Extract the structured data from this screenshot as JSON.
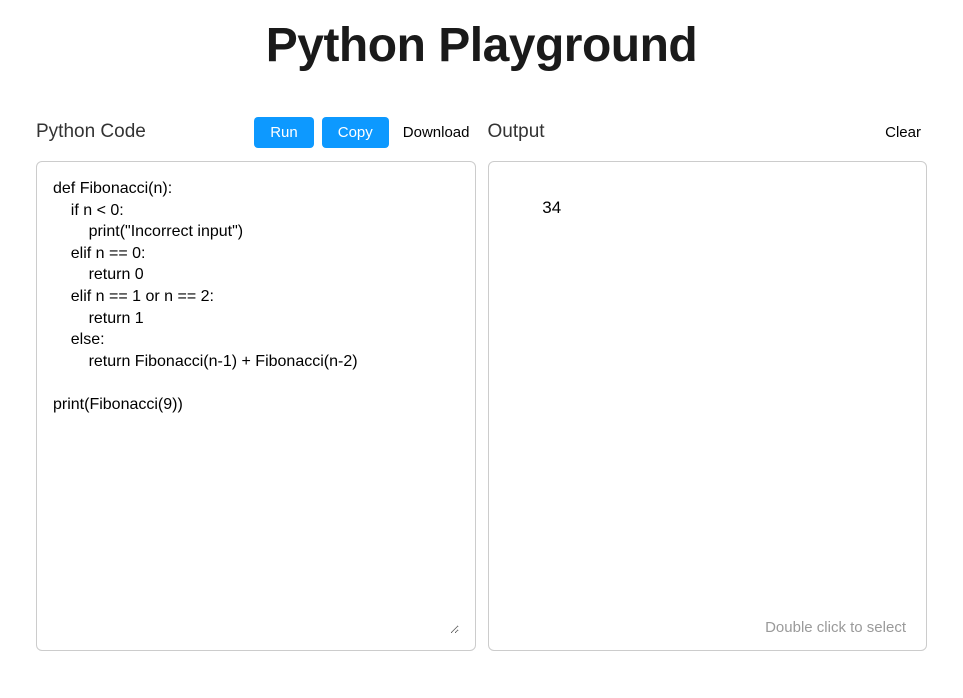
{
  "title": "Python Playground",
  "left": {
    "label": "Python Code",
    "buttons": {
      "run": "Run",
      "copy": "Copy",
      "download": "Download"
    },
    "code": "def Fibonacci(n):\n    if n < 0:\n        print(\"Incorrect input\")\n    elif n == 0:\n        return 0\n    elif n == 1 or n == 2:\n        return 1\n    else:\n        return Fibonacci(n-1) + Fibonacci(n-2)\n\nprint(Fibonacci(9))"
  },
  "right": {
    "label": "Output",
    "buttons": {
      "clear": "Clear"
    },
    "output": "34",
    "hint": "Double click to select"
  }
}
